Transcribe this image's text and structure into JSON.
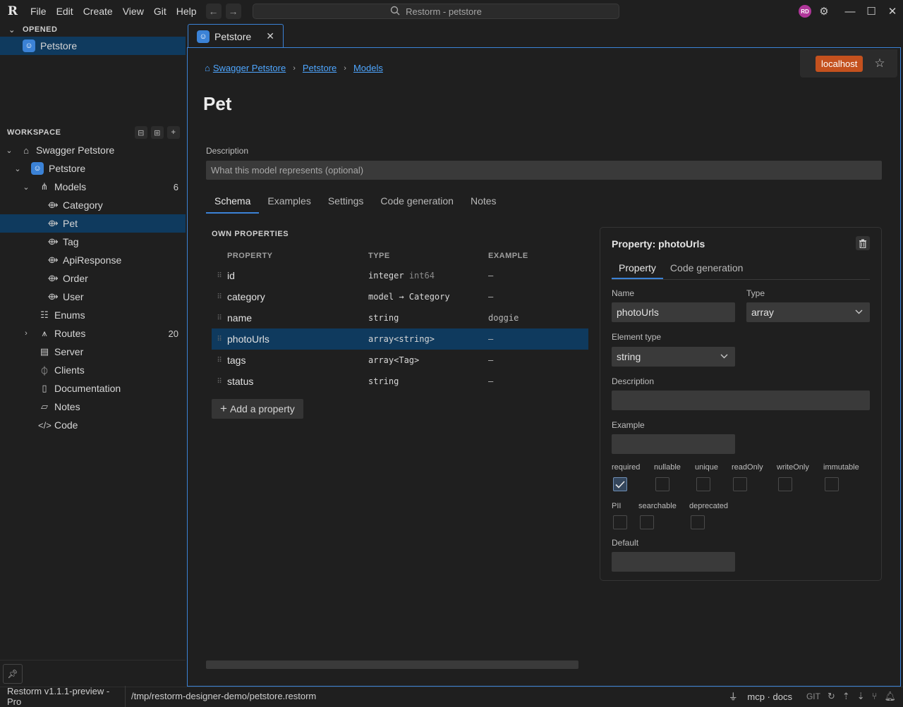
{
  "titlebar": {
    "menus": [
      "File",
      "Edit",
      "Create",
      "View",
      "Git",
      "Help"
    ],
    "search_text": "Restorm - petstore",
    "avatar_initials": "RD"
  },
  "sidebar": {
    "opened_header": "OPENED",
    "opened_item": "Petstore",
    "workspace_header": "WORKSPACE",
    "tree": {
      "root": "Swagger Petstore",
      "project": "Petstore",
      "models_label": "Models",
      "models_count": "6",
      "models": [
        "Category",
        "Pet",
        "Tag",
        "ApiResponse",
        "Order",
        "User"
      ],
      "enums": "Enums",
      "routes": "Routes",
      "routes_count": "20",
      "server": "Server",
      "clients": "Clients",
      "documentation": "Documentation",
      "notes": "Notes",
      "code": "Code"
    }
  },
  "editor": {
    "tab_label": "Petstore",
    "server_button": "localhost",
    "breadcrumb": [
      "Swagger Petstore",
      "Petstore",
      "Models"
    ],
    "title": "Pet",
    "description_label": "Description",
    "description_placeholder": "What this model represents (optional)",
    "tabs": [
      "Schema",
      "Examples",
      "Settings",
      "Code generation",
      "Notes"
    ],
    "own_properties_header": "OWN PROPERTIES",
    "columns": [
      "PROPERTY",
      "TYPE",
      "EXAMPLE"
    ],
    "rows": [
      {
        "name": "id",
        "type": "integer",
        "format": "int64",
        "example": "–"
      },
      {
        "name": "category",
        "type": "model → Category",
        "format": "",
        "example": "–"
      },
      {
        "name": "name",
        "type": "string",
        "format": "",
        "example": "doggie"
      },
      {
        "name": "photoUrls",
        "type": "array<string>",
        "format": "",
        "example": "–"
      },
      {
        "name": "tags",
        "type": "array<Tag>",
        "format": "",
        "example": "–"
      },
      {
        "name": "status",
        "type": "string",
        "format": "",
        "example": "–"
      }
    ],
    "add_property_label": "Add a property"
  },
  "property_panel": {
    "title": "Property: photoUrls",
    "tabs": [
      "Property",
      "Code generation"
    ],
    "name_label": "Name",
    "name_value": "photoUrls",
    "type_label": "Type",
    "type_value": "array",
    "element_type_label": "Element type",
    "element_type_value": "string",
    "description_label": "Description",
    "example_label": "Example",
    "flags_row1": [
      "required",
      "nullable",
      "unique",
      "readOnly",
      "writeOnly",
      "immutable"
    ],
    "flags_row2": [
      "PII",
      "searchable",
      "deprecated"
    ],
    "required_checked": true,
    "default_label": "Default"
  },
  "statusbar": {
    "version": "Restorm v1.1.1-preview - Pro",
    "path": "/tmp/restorm-designer-demo/petstore.restorm",
    "mcp": "mcp · docs",
    "git": "GIT"
  },
  "colors": {
    "accent": "#3b82d6",
    "selection": "#0f3a5e",
    "server_button": "#c4511e",
    "avatar": "#b0369a"
  }
}
